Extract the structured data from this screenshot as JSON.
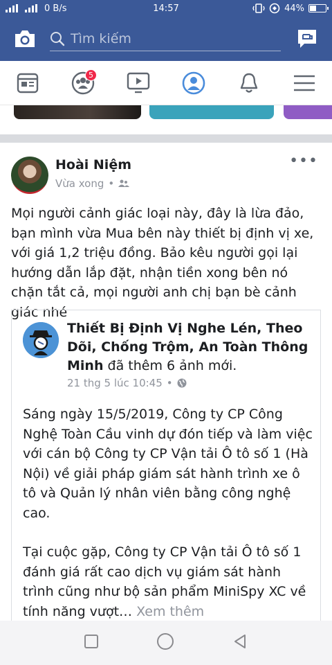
{
  "status_bar": {
    "signal": "⁴ᴳ",
    "speed": "0 B/s",
    "time": "14:57",
    "battery": "44%",
    "battery_level": 0.44
  },
  "top_bar": {
    "search_placeholder": "Tìm kiếm",
    "icons": [
      "camera-icon",
      "search-icon",
      "messenger-icon"
    ]
  },
  "nav_tabs": {
    "items": [
      "news-feed",
      "friends",
      "watch",
      "profile",
      "notifications",
      "menu"
    ],
    "friends_badge": "5"
  },
  "post": {
    "author": "Hoài Niệm",
    "time": "Vừa xong",
    "dot": "•",
    "text": "Mọi người cảnh giác loại này, đây là lừa đảo, bạn mình vừa Mua bên này thiết bị định vị xe, với giá  1,2 triệu đồng.  Bảo kêu người gọi lại hướng dẫn lắp đặt, nhận tiền xong bên nó chặn tắt cả, mọi người anh chị bạn bè cảnh giác nhé",
    "more": "•••"
  },
  "shared": {
    "page_name": "Thiết Bị Định Vị Nghe Lén, Theo Dõi, Chống Trộm, An Toàn Thông Minh",
    "action": " đã thêm 6 ảnh mới.",
    "time": "21 thg 5 lúc 10:45",
    "dot": "•",
    "paragraph1": "Sáng ngày 15/5/2019, Công ty CP Công Nghệ Toàn Cầu vinh dự đón tiếp và làm việc với cán bộ Công ty CP Vận tải Ô tô số 1 (Hà Nội) về giải pháp giám sát hành trình xe ô tô và Quản lý nhân viên bằng công nghệ cao.",
    "paragraph2": "Tại cuộc gặp, Công ty CP Vận tải Ô tô số 1 đánh giá rất cao dịch vụ giám sát hành trình cũng như bộ sản phẩm MiniSpy XC về tính năng vượt…",
    "see_more": " Xem thêm"
  },
  "colors": {
    "brand": "#3b5998",
    "badge": "#f02849",
    "meta": "#90949c"
  }
}
